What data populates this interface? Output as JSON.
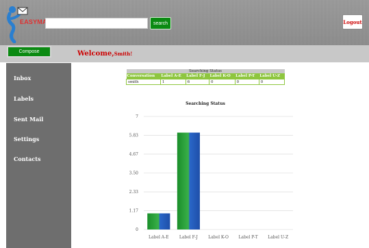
{
  "header": {
    "logo_text": "EASYMAIL",
    "search_input": {
      "value": "",
      "placeholder": ""
    },
    "search_button": "search",
    "logout_button": "Logout"
  },
  "subbar": {
    "compose_button": "Compose",
    "welcome_text": "Welcome,",
    "user_name": "Smith!"
  },
  "sidebar": {
    "items": [
      {
        "label": "Inbox"
      },
      {
        "label": "Labels"
      },
      {
        "label": "Sent Mail"
      },
      {
        "label": "Settings"
      },
      {
        "label": "Contacts"
      }
    ]
  },
  "status_table": {
    "caption": "Searching Status",
    "headers": [
      "Conversation",
      "Label A-E",
      "Label F-J",
      "Label K-O",
      "Label P-T",
      "Label U-Z"
    ],
    "rows": [
      [
        "smith",
        "1",
        "6",
        "0",
        "0",
        "0"
      ]
    ]
  },
  "chart_data": {
    "type": "bar",
    "title": "Searching Status",
    "categories": [
      "Label A-E",
      "Label F-J",
      "Label K-O",
      "Label P-T",
      "Label U-Z"
    ],
    "values": [
      1,
      6,
      0,
      0,
      0
    ],
    "yticks": [
      "0",
      "1.17",
      "2.33",
      "3.50",
      "4.67",
      "5.83",
      "7"
    ],
    "ylim": [
      0,
      7
    ],
    "grid": true,
    "bar_color": "#1a8f2a"
  },
  "colors": {
    "brand_green": "#0b8a12",
    "header_green": "#8ec63f",
    "accent_red": "#cc0000",
    "sidebar_bg": "#6e6e6e"
  }
}
